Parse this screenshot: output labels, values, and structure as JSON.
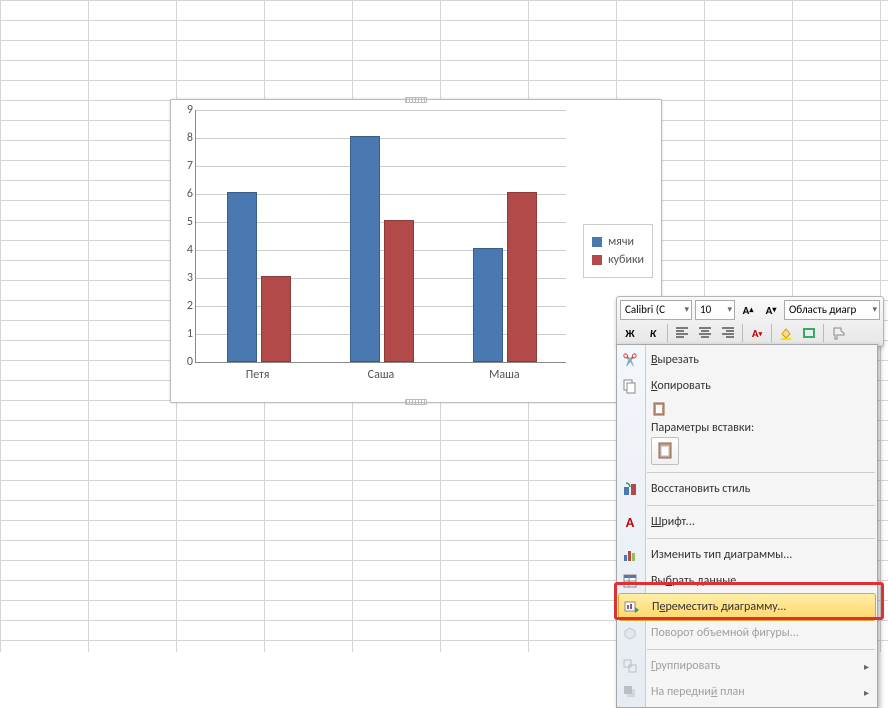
{
  "chart_data": {
    "type": "bar",
    "categories": [
      "Петя",
      "Саша",
      "Маша"
    ],
    "series": [
      {
        "name": "мячи",
        "values": [
          6,
          8,
          4
        ],
        "color": "#4a78b0"
      },
      {
        "name": "кубики",
        "values": [
          3,
          5,
          6
        ],
        "color": "#b24a4a"
      }
    ],
    "ylim": [
      0,
      9
    ],
    "ystep": 1,
    "xlabel": "",
    "ylabel": "",
    "title": ""
  },
  "legend": {
    "items": [
      "мячи",
      "кубики"
    ]
  },
  "mini_toolbar": {
    "font_name": "Calibri (С",
    "font_size": "10",
    "style_box": "Область диагр"
  },
  "context_menu": {
    "cut": "Вырезать",
    "copy": "Копировать",
    "paste_header": "Параметры вставки:",
    "reset_style": "Восстановить стиль",
    "font": "Шрифт...",
    "change_type": "Изменить тип диаграммы...",
    "select_data": "Выбрать данные...",
    "move_chart": "Переместить диаграмму...",
    "rotate_3d": "Поворот объемной фигуры...",
    "group": "Группировать",
    "bring_front": "На передний план"
  }
}
